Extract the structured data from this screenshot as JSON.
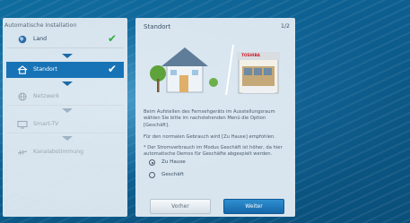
{
  "steps_panel": {
    "title": "Automatische Installation",
    "items": [
      {
        "label": "Land",
        "icon": "globe-icon",
        "state": "done"
      },
      {
        "label": "Standort",
        "icon": "house-icon",
        "state": "active"
      },
      {
        "label": "Netzwerk",
        "icon": "network-globe-icon",
        "state": "pending"
      },
      {
        "label": "Smart-TV",
        "icon": "smart-tv-icon",
        "state": "pending"
      },
      {
        "label": "Kanalabstimmung",
        "icon": "antenna-icon",
        "state": "pending"
      }
    ],
    "check_glyph": "✔"
  },
  "content_panel": {
    "title": "Standort",
    "page": "1/2",
    "store_sign": "TOSHIBA",
    "paragraph1": "Beim Aufstellen des Fernsehgeräts im Ausstellungsraum wählen Sie bitte im nachstehenden Menü die Option [Geschäft].",
    "paragraph2": "Für den normalen Gebrauch wird [Zu Hause] empfohlen.",
    "paragraph3": "* Der Stromverbrauch im Modus Geschäft ist höher, da hier automatische Demos für Geschäfte abgespielt werden.",
    "options": [
      {
        "label": "Zu Hause",
        "selected": true
      },
      {
        "label": "Geschäft",
        "selected": false
      }
    ],
    "back_button": "Vorher",
    "next_button": "Weiter"
  },
  "colors": {
    "accent": "#1873b6",
    "check_done": "#2fae3a",
    "check_active": "#ffffff"
  }
}
